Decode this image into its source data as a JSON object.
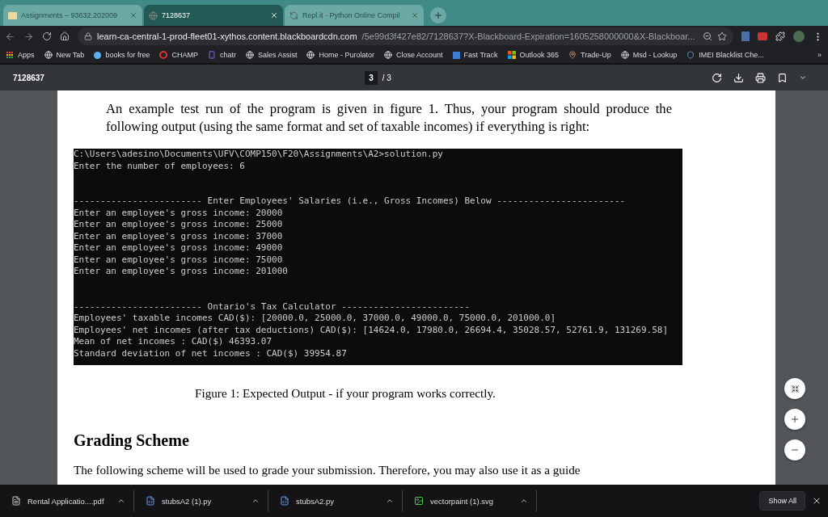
{
  "tabs": [
    {
      "title": "Assignments – 93632.202009",
      "selected": false
    },
    {
      "title": "7128637",
      "selected": true
    },
    {
      "title": "Repl.it - Python Online Compil",
      "selected": false
    }
  ],
  "address": {
    "host": "learn-ca-central-1-prod-fleet01-xythos.content.blackboardcdn.com",
    "path": "/5e99d3f427e82/7128637?X-Blackboard-Expiration=1605258000000&X-Blackboar..."
  },
  "bookmarks": [
    "Apps",
    "New Tab",
    "books for free",
    "CHAMP",
    "chatr",
    "Sales Assist",
    "Home - Purolator",
    "Close Account",
    "Fast Track",
    "Outlook 365",
    "Trade-Up",
    "Msd - Lookup",
    "IMEI Blacklist Che..."
  ],
  "overflow": "»",
  "pdf_toolbar": {
    "title": "7128637",
    "page": "3",
    "total": "/ 3"
  },
  "document": {
    "intro": "An example test run of the program is given in figure 1. Thus, your program should produce the following output (using the same format and set of taxable incomes) if everything is right:",
    "terminal": [
      [
        "C:\\Users\\adesino\\Documents\\UFV\\COMP150\\F20\\Assignments\\A2>solution.py",
        "Enter the number of employees: 6"
      ],
      [
        "------------------------ Enter Employees' Salaries (i.e., Gross Incomes) Below ------------------------",
        "Enter an employee's gross income: 20000",
        "Enter an employee's gross income: 25000",
        "Enter an employee's gross income: 37000",
        "Enter an employee's gross income: 49000",
        "Enter an employee's gross income: 75000",
        "Enter an employee's gross income: 201000"
      ],
      [
        "------------------------ Ontario's Tax Calculator ------------------------",
        "Employees' taxable incomes CAD($): [20000.0, 25000.0, 37000.0, 49000.0, 75000.0, 201000.0]",
        "Employees' net incomes (after tax deductions) CAD($): [14624.0, 17980.0, 26694.4, 35028.57, 52761.9, 131269.58]",
        "Mean of net incomes : CAD($) 46393.07",
        "Standard deviation of net incomes : CAD($) 39954.87"
      ]
    ],
    "caption": "Figure 1: Expected Output - if your program works correctly.",
    "heading": "Grading Scheme",
    "closing": "The following scheme will be used to grade your submission. Therefore, you may also use it as a guide"
  },
  "downloads": [
    {
      "name": "Rental Applicatio....pdf",
      "kind": "pdf"
    },
    {
      "name": "stubsA2 (1).py",
      "kind": "py"
    },
    {
      "name": "stubsA2.py",
      "kind": "py"
    },
    {
      "name": "vectorpaint (1).svg",
      "kind": "svg"
    }
  ],
  "show_all": "Show All"
}
